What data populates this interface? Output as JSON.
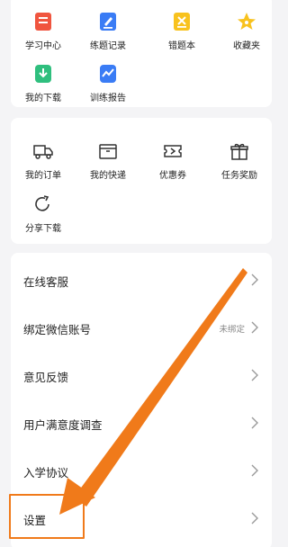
{
  "study_grid": [
    {
      "label": "学习中心",
      "icon": "study-center-icon",
      "color": "#f0553f"
    },
    {
      "label": "练题记录",
      "icon": "practice-record-icon",
      "color": "#3a7cf5"
    },
    {
      "label": "错题本",
      "icon": "mistake-book-icon",
      "color": "#f8c21e"
    },
    {
      "label": "收藏夹",
      "icon": "favorites-star-icon",
      "color": "#f8c21e"
    },
    {
      "label": "我的下载",
      "icon": "my-download-icon",
      "color": "#2fbf7e"
    },
    {
      "label": "训练报告",
      "icon": "training-report-icon",
      "color": "#3a7cf5"
    }
  ],
  "service_grid": [
    {
      "label": "我的订单",
      "icon": "truck-icon"
    },
    {
      "label": "我的快递",
      "icon": "package-icon"
    },
    {
      "label": "优惠券",
      "icon": "coupon-icon"
    },
    {
      "label": "任务奖励",
      "icon": "gift-icon"
    },
    {
      "label": "分享下载",
      "icon": "share-icon"
    }
  ],
  "menu": [
    {
      "label": "在线客服",
      "value": ""
    },
    {
      "label": "绑定微信账号",
      "value": "未绑定"
    },
    {
      "label": "意见反馈",
      "value": ""
    },
    {
      "label": "用户满意度调查",
      "value": ""
    },
    {
      "label": "入学协议",
      "value": ""
    },
    {
      "label": "设置",
      "value": ""
    }
  ],
  "annotation_color": "#f07a1a"
}
